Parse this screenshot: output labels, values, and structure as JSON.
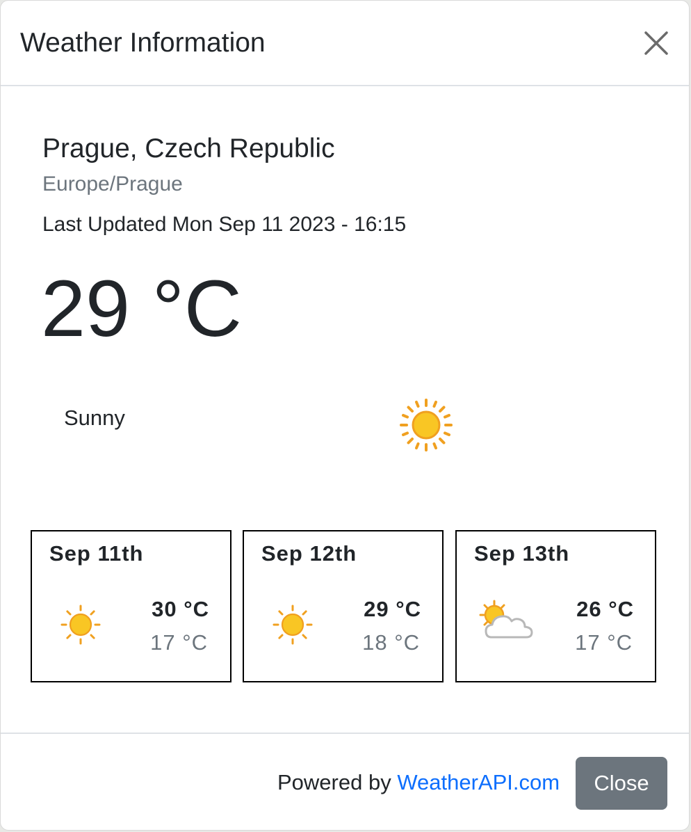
{
  "header": {
    "title": "Weather Information",
    "close_icon": "close-icon"
  },
  "location": {
    "name": "Prague, Czech Republic",
    "timezone": "Europe/Prague",
    "last_updated": "Last Updated Mon Sep 11 2023 - 16:15"
  },
  "current": {
    "temperature": "29 °C",
    "condition": "Sunny",
    "icon": "sun-icon"
  },
  "forecast": [
    {
      "date": "Sep 11th",
      "high": "30 °C",
      "low": "17 °C",
      "icon": "sun-icon"
    },
    {
      "date": "Sep 12th",
      "high": "29 °C",
      "low": "18 °C",
      "icon": "sun-icon"
    },
    {
      "date": "Sep 13th",
      "high": "26 °C",
      "low": "17 °C",
      "icon": "partly-cloudy-icon"
    }
  ],
  "footer": {
    "powered_prefix": "Powered by ",
    "powered_link": "WeatherAPI.com",
    "close_label": "Close"
  },
  "colors": {
    "link": "#0d6efd",
    "button_bg": "#6c757d",
    "muted": "#6c757d",
    "sun": "#f9c624",
    "sun_rays": "#f0a020"
  }
}
